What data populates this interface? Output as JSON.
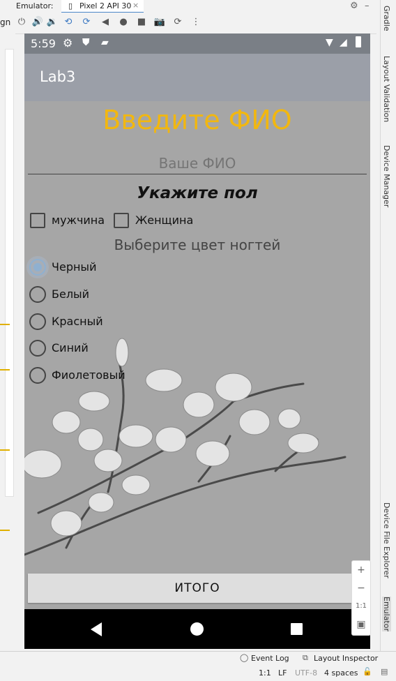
{
  "ide": {
    "left_panel_label": "gn",
    "emulator_label": "Emulator:",
    "device_tab": "Pixel 2 API 30",
    "tab_close": "×",
    "right_tabs": [
      "Gradle",
      "Layout Validation",
      "Device Manager",
      "Device File Explorer",
      "Emulator"
    ],
    "status_left_items": [
      "Event Log",
      "Layout Inspector"
    ],
    "status_bottom": [
      "1:1",
      "LF",
      "UTF-8",
      "4 spaces"
    ]
  },
  "toolbar_icons": [
    "power-icon",
    "volume-up-icon",
    "volume-down-icon",
    "rotate-left-icon",
    "rotate-right-icon",
    "back-icon",
    "home-icon",
    "overview-icon",
    "camera-icon",
    "snapshot-icon",
    "more-icon"
  ],
  "phone": {
    "time": "5:59",
    "app_title": "Lab3",
    "heading": "Введите ФИО",
    "name_placeholder": "Ваше ФИО",
    "gender_heading": "Укажите пол",
    "gender_options": [
      "мужчина",
      "Женщина"
    ],
    "nail_heading": "Выберите цвет ногтей",
    "nail_options": [
      "Черный",
      "Белый",
      "Красный",
      "Синий",
      "Фиолетовый"
    ],
    "selected_nail_index": 0,
    "total_button": "ИТОГО"
  },
  "zoom": {
    "plus": "+",
    "minus": "−",
    "ratio": "1:1"
  },
  "colors": {
    "heading": "#f2b70f",
    "appbar": "#9b9fa8",
    "selected_radio": "#8fb0d0"
  }
}
